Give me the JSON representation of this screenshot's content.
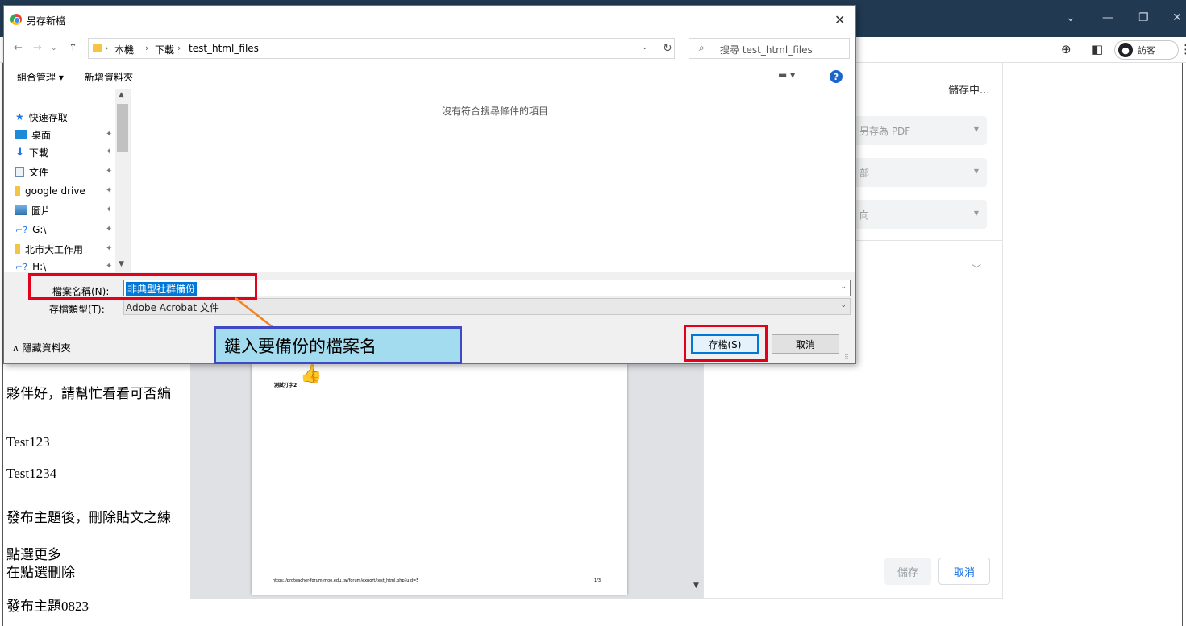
{
  "dialog": {
    "title": "另存新檔",
    "close_icon": "close-icon",
    "breadcrumb": [
      "本機",
      "下載",
      "test_html_files"
    ],
    "search_placeholder": "搜尋 test_html_files",
    "toolbar": {
      "organize": "組合管理 ▾",
      "new_folder": "新增資料夾"
    },
    "nav_items": [
      {
        "label": "快速存取",
        "icon": "star-icon",
        "pinned": false
      },
      {
        "label": "桌面",
        "icon": "desktop-icon",
        "pinned": true
      },
      {
        "label": "下載",
        "icon": "download-icon",
        "pinned": true
      },
      {
        "label": "文件",
        "icon": "document-icon",
        "pinned": true
      },
      {
        "label": "google drive",
        "icon": "folder-icon",
        "pinned": true
      },
      {
        "label": "圖片",
        "icon": "picture-icon",
        "pinned": true
      },
      {
        "label": "G:\\",
        "icon": "network-drive-icon",
        "pinned": true
      },
      {
        "label": "北市大工作用",
        "icon": "folder-icon",
        "pinned": true
      },
      {
        "label": "H:\\",
        "icon": "network-drive-icon",
        "pinned": true
      }
    ],
    "empty_message": "沒有符合搜尋條件的項目",
    "filename_label": "檔案名稱(N):",
    "filename_value": "非典型社群備份",
    "filetype_label": "存檔類型(T):",
    "filetype_value": "Adobe Acrobat 文件",
    "hide_folders": "∧ 隱藏資料夾",
    "save_label": "存檔(S)",
    "cancel_label": "取消"
  },
  "annotation": {
    "callout_text": "鍵入要備份的檔案名"
  },
  "chrome": {
    "guest_label": "訪客"
  },
  "print_panel": {
    "saving_text": "儲存中...",
    "destination_value": "另存為 PDF",
    "row2_fragment": "部",
    "row3_fragment": "向",
    "save_label": "儲存",
    "cancel_label": "取消"
  },
  "preview": {
    "sheet_text": "測試打字2",
    "footer_url": "https://proteacher-forum.moe.edu.tw/forum/export/test_html.php?uid=5",
    "page_number": "1/3"
  },
  "page_text": [
    "夥伴好，請幫忙看看可否編",
    "Test123",
    "Test1234",
    "發布主題後，刪除貼文之練",
    "點選更多",
    "在點選刪除",
    "發布主題0823"
  ],
  "colors": {
    "dialog_title_bar": "#213a52",
    "annotation_red": "#e3001b",
    "callout_fill": "#a4dcef",
    "callout_border": "#3f49c6",
    "selection_blue": "#0078d7"
  }
}
